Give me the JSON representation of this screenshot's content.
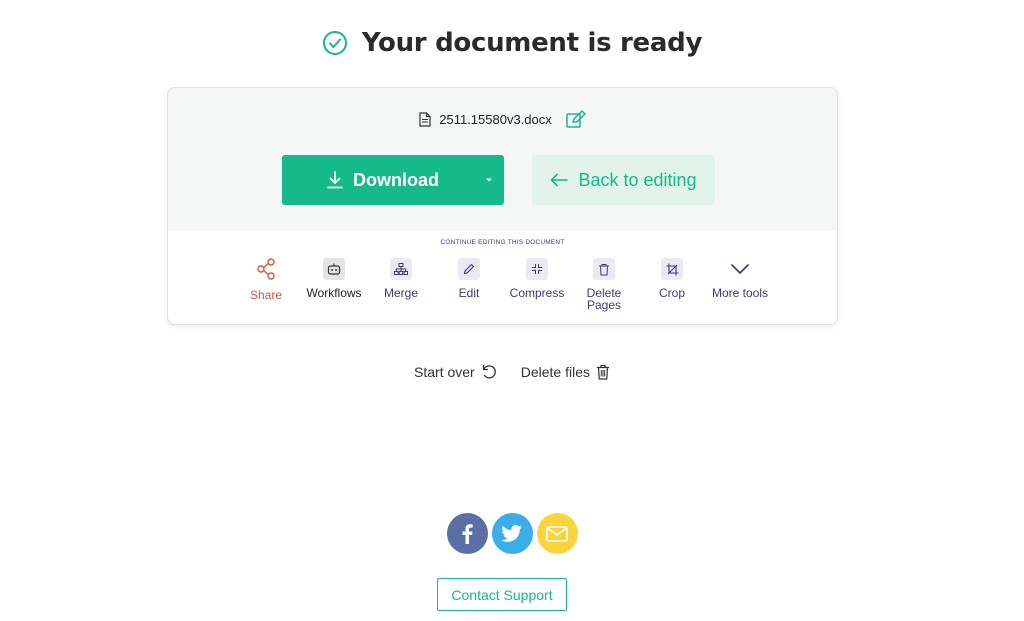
{
  "header": {
    "title": "Your document is ready"
  },
  "file": {
    "name": "2511.15580v3.docx"
  },
  "buttons": {
    "download": "Download",
    "back": "Back to editing"
  },
  "continue_label": "CONTINUE EDITING THIS DOCUMENT",
  "tools": {
    "share": "Share",
    "workflows": "Workflows",
    "merge": "Merge",
    "edit": "Edit",
    "compress": "Compress",
    "delete_pages_1": "Delete",
    "delete_pages_2": "Pages",
    "crop": "Crop",
    "more": "More tools"
  },
  "actions": {
    "start_over": "Start over",
    "delete_files": "Delete files"
  },
  "support": "Contact Support",
  "colors": {
    "accent": "#15b98a",
    "share": "#e8503a",
    "tool_text": "#3a3a7e",
    "facebook": "#5a6fa6",
    "twitter": "#3aaee8",
    "email": "#fbd33d"
  }
}
